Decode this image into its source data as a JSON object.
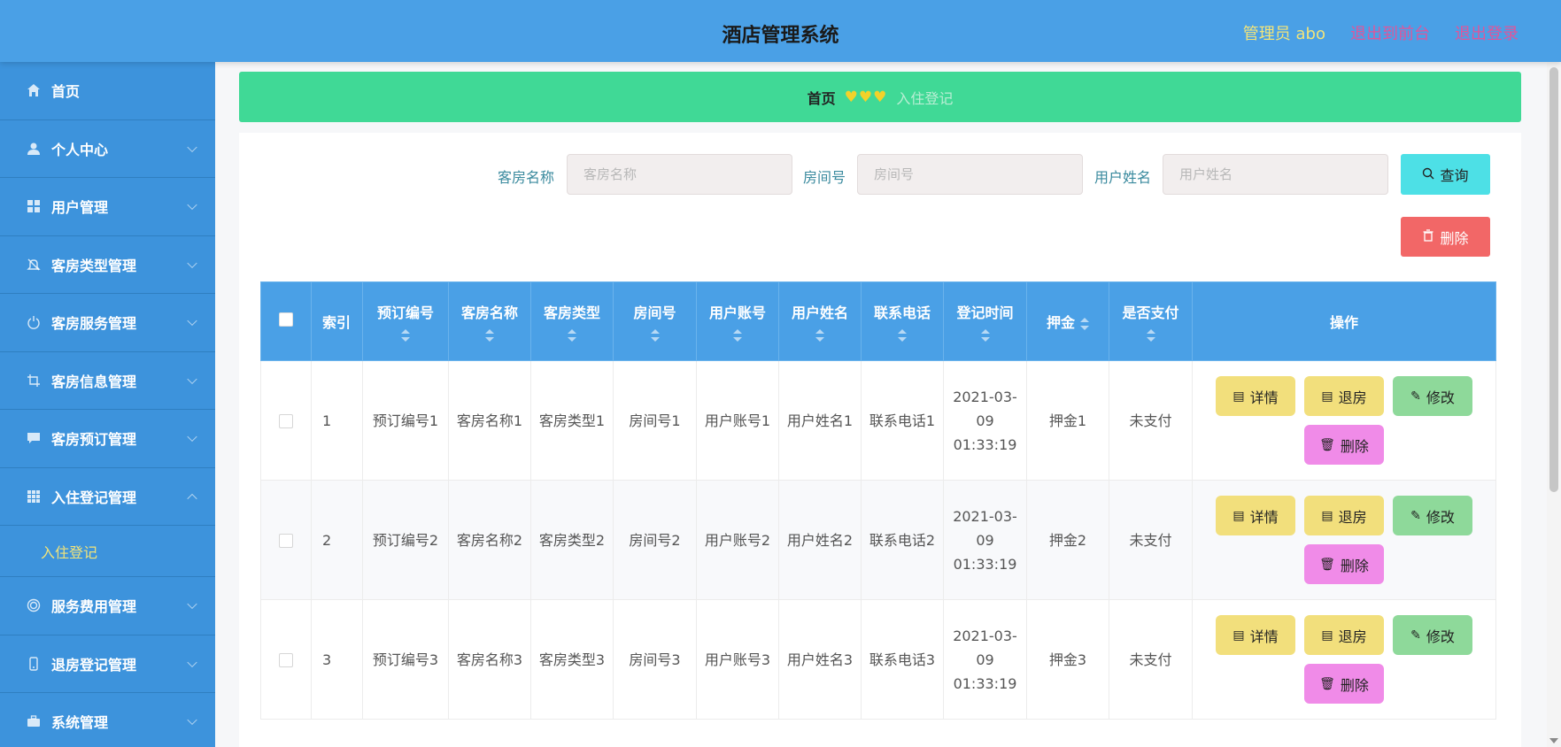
{
  "header": {
    "title": "酒店管理系统",
    "admin": "管理员 abo",
    "exit_front": "退出到前台",
    "logout": "退出登录"
  },
  "sidebar": {
    "items": [
      {
        "label": "首页",
        "icon": "home-icon"
      },
      {
        "label": "个人中心",
        "icon": "user-icon"
      },
      {
        "label": "用户管理",
        "icon": "grid-icon"
      },
      {
        "label": "客房类型管理",
        "icon": "bell-off-icon"
      },
      {
        "label": "客房服务管理",
        "icon": "power-icon"
      },
      {
        "label": "客房信息管理",
        "icon": "crop-icon"
      },
      {
        "label": "客房预订管理",
        "icon": "chat-icon"
      },
      {
        "label": "入住登记管理",
        "icon": "apps-icon"
      },
      {
        "label": "服务费用管理",
        "icon": "circle-icon"
      },
      {
        "label": "退房登记管理",
        "icon": "mobile-icon"
      },
      {
        "label": "系统管理",
        "icon": "briefcase-icon"
      }
    ],
    "sub_item": "入住登记"
  },
  "breadcrumb": {
    "home": "首页",
    "hearts": "♥♥♥",
    "current": "入住登记"
  },
  "search": {
    "room_name_label": "客房名称",
    "room_name_placeholder": "客房名称",
    "room_no_label": "房间号",
    "room_no_placeholder": "房间号",
    "user_name_label": "用户姓名",
    "user_name_placeholder": "用户姓名",
    "query_button": "查询",
    "delete_button": "删除"
  },
  "table": {
    "headers": [
      "索引",
      "预订编号",
      "客房名称",
      "客房类型",
      "房间号",
      "用户账号",
      "用户姓名",
      "联系电话",
      "登记时间",
      "押金",
      "是否支付",
      "操作"
    ],
    "rows": [
      {
        "index": "1",
        "booking_no": "预订编号1",
        "room_name": "客房名称1",
        "room_type": "客房类型1",
        "room_no": "房间号1",
        "account": "用户账号1",
        "user_name": "用户姓名1",
        "phone": "联系电话1",
        "time": "2021-03-09 01:33:19",
        "deposit": "押金1",
        "paid": "未支付"
      },
      {
        "index": "2",
        "booking_no": "预订编号2",
        "room_name": "客房名称2",
        "room_type": "客房类型2",
        "room_no": "房间号2",
        "account": "用户账号2",
        "user_name": "用户姓名2",
        "phone": "联系电话2",
        "time": "2021-03-09 01:33:19",
        "deposit": "押金2",
        "paid": "未支付"
      },
      {
        "index": "3",
        "booking_no": "预订编号3",
        "room_name": "客房名称3",
        "room_type": "客房类型3",
        "room_no": "房间号3",
        "account": "用户账号3",
        "user_name": "用户姓名3",
        "phone": "联系电话3",
        "time": "2021-03-09 01:33:19",
        "deposit": "押金3",
        "paid": "未支付"
      }
    ],
    "actions": {
      "detail": "详情",
      "checkout": "退房",
      "edit": "修改",
      "delete": "删除"
    }
  },
  "colors": {
    "header_bg": "#4aa0e6",
    "sidebar_bg": "#3d93dc",
    "breadcrumb_bg": "#40d996",
    "query_btn": "#4de0e6",
    "delete_btn": "#f26767",
    "yellow_btn": "#f2df7c",
    "green_btn": "#8ed99a",
    "pink_btn": "#f08be8"
  }
}
